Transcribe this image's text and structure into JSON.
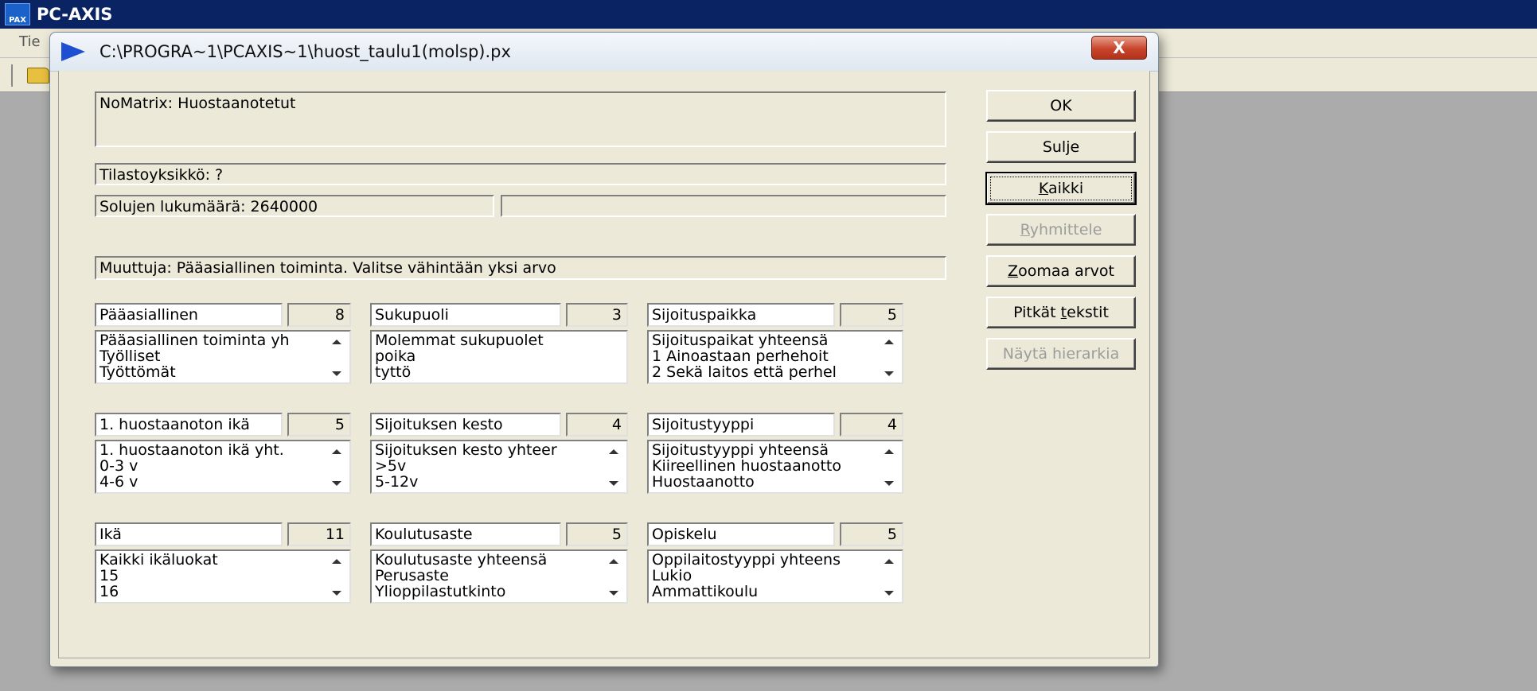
{
  "app": {
    "title": "PC-AXIS",
    "logo_text": "PAX",
    "menu_first": "Tie"
  },
  "dialog": {
    "title": "C:\\PROGRA~1\\PCAXIS~1\\huost_taulu1(molsp).px",
    "close_label": "X",
    "matrix_text": "NoMatrix: Huostaanotetut",
    "unit_text": "Tilastoyksikkö: ?",
    "cells_text": "Solujen lukumäärä:  2640000",
    "cells_extra": "",
    "variable_text": "Muuttuja: Pääasiallinen toiminta. Valitse vähintään yksi arvo"
  },
  "variables": [
    {
      "name": "Pääasiallinen",
      "count": "8",
      "items": [
        "Pääasiallinen toiminta yh",
        "Työlliset",
        "Työttömät"
      ]
    },
    {
      "name": "Sukupuoli",
      "count": "3",
      "items": [
        "Molemmat sukupuolet",
        "poika",
        "tyttö"
      ]
    },
    {
      "name": "Sijoituspaikka",
      "count": "5",
      "items": [
        "Sijoituspaikat yhteensä",
        "1  Ainoastaan perhehoit",
        "2 Sekä laitos että perhel"
      ]
    },
    {
      "name": "1. huostaanoton ikä",
      "count": "5",
      "items": [
        "1. huostaanoton ikä yht.",
        "0-3 v",
        "4-6 v"
      ]
    },
    {
      "name": "Sijoituksen kesto",
      "count": "4",
      "items": [
        "Sijoituksen kesto yhteer",
        ">5v",
        "5-12v"
      ]
    },
    {
      "name": "Sijoitustyyppi",
      "count": "4",
      "items": [
        "Sijoitustyyppi yhteensä",
        "Kiireellinen huostaanotto",
        "Huostaanotto"
      ]
    },
    {
      "name": "Ikä",
      "count": "11",
      "items": [
        "Kaikki ikäluokat",
        "15",
        "16"
      ]
    },
    {
      "name": "Koulutusaste",
      "count": "5",
      "items": [
        "Koulutusaste yhteensä",
        "Perusaste",
        "Ylioppilastutkinto"
      ]
    },
    {
      "name": "Opiskelu",
      "count": "5",
      "items": [
        "Oppilaitostyyppi yhteens",
        "Lukio",
        "Ammattikoulu"
      ]
    }
  ],
  "buttons": {
    "ok": "OK",
    "close": "Sulje",
    "all_key": "K",
    "all_rest": "aikki",
    "group_key": "R",
    "group_rest": "yhmittele",
    "zoom_key": "Z",
    "zoom_rest": "oomaa arvot",
    "long_pre": "Pitkät ",
    "long_key": "t",
    "long_rest": "ekstit",
    "hierarchy": "Näytä hierarkia"
  }
}
